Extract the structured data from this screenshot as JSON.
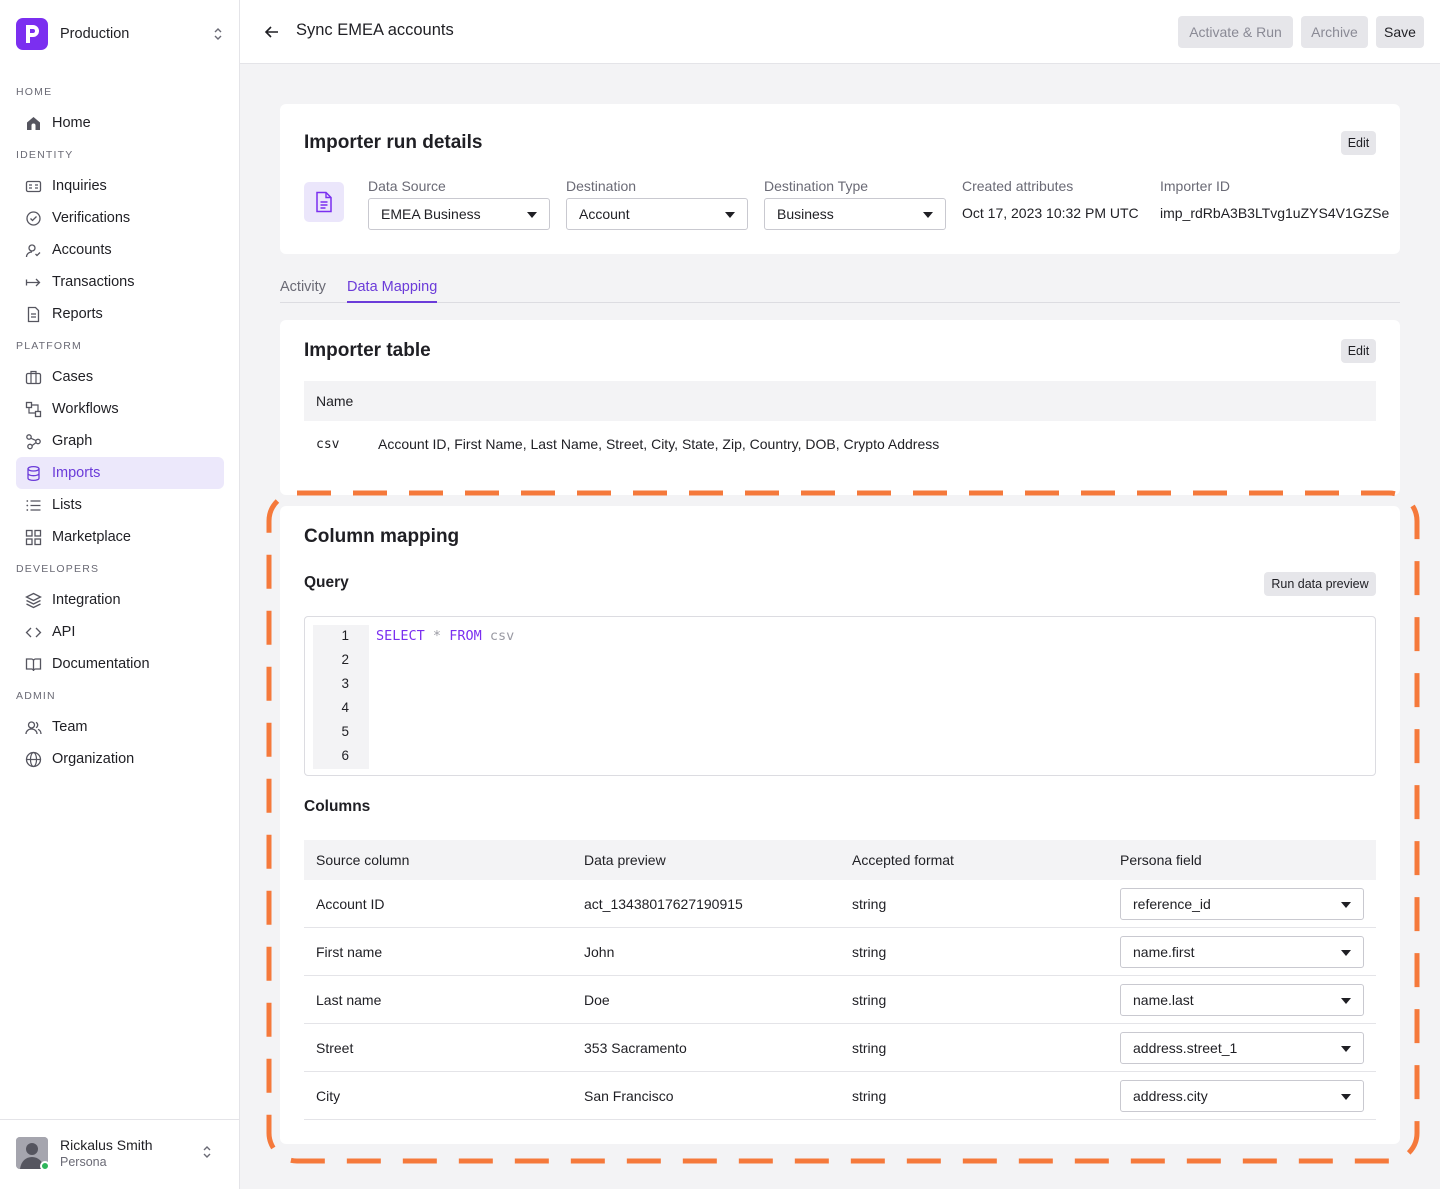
{
  "org": {
    "name": "Production"
  },
  "sidebar": {
    "sections": {
      "home": "HOME",
      "identity": "IDENTITY",
      "platform": "PLATFORM",
      "developers": "DEVELOPERS",
      "admin": "ADMIN"
    },
    "items": {
      "home": "Home",
      "inquiries": "Inquiries",
      "verifications": "Verifications",
      "accounts": "Accounts",
      "transactions": "Transactions",
      "reports": "Reports",
      "cases": "Cases",
      "workflows": "Workflows",
      "graph": "Graph",
      "imports": "Imports",
      "lists": "Lists",
      "marketplace": "Marketplace",
      "integration": "Integration",
      "api": "API",
      "documentation": "Documentation",
      "team": "Team",
      "organization": "Organization"
    },
    "active_item": "imports",
    "user": {
      "name": "Rickalus Smith",
      "subtitle": "Persona"
    }
  },
  "header": {
    "title": "Sync EMEA accounts",
    "activate_label": "Activate & Run",
    "archive_label": "Archive",
    "save_label": "Save"
  },
  "run_details": {
    "title": "Importer run details",
    "edit_label": "Edit",
    "data_source": {
      "label": "Data Source",
      "value": "EMEA Business"
    },
    "destination": {
      "label": "Destination",
      "value": "Account"
    },
    "destination_type": {
      "label": "Destination Type",
      "value": "Business"
    },
    "created": {
      "label": "Created attributes",
      "value": "Oct 17, 2023 10:32 PM UTC"
    },
    "importer_id": {
      "label": "Importer ID",
      "value": "imp_rdRbA3B3LTvg1uZYS4V1GZSe"
    }
  },
  "tabs": [
    {
      "label": "Activity",
      "active": false
    },
    {
      "label": "Data Mapping",
      "active": true
    }
  ],
  "importer_table": {
    "title": "Importer table",
    "edit_label": "Edit",
    "header": "Name",
    "row": {
      "name": "csv",
      "columns": "Account ID, First Name, Last Name, Street, City, State, Zip, Country, DOB, Crypto Address"
    }
  },
  "column_mapping": {
    "title": "Column mapping",
    "query_label": "Query",
    "run_preview_label": "Run data preview",
    "line_numbers": [
      "1",
      "2",
      "3",
      "4",
      "5",
      "6"
    ],
    "query": {
      "select": "SELECT",
      "star": "*",
      "from": "FROM",
      "table": "csv"
    },
    "columns_label": "Columns",
    "headers": [
      "Source column",
      "Data preview",
      "Accepted format",
      "Persona field"
    ],
    "rows": [
      {
        "source": "Account ID",
        "preview": "act_13438017627190915",
        "format": "string",
        "field": "reference_id"
      },
      {
        "source": "First name",
        "preview": "John",
        "format": "string",
        "field": "name.first"
      },
      {
        "source": "Last name",
        "preview": "Doe",
        "format": "string",
        "field": "name.last"
      },
      {
        "source": "Street",
        "preview": "353 Sacramento",
        "format": "string",
        "field": "address.street_1"
      },
      {
        "source": "City",
        "preview": "San Francisco",
        "format": "string",
        "field": "address.city"
      }
    ]
  },
  "colors": {
    "accent": "#7b2ff0",
    "active_nav_bg": "#ece8fb",
    "highlight_dash": "#f5793b",
    "status_online": "#2fb55b"
  }
}
